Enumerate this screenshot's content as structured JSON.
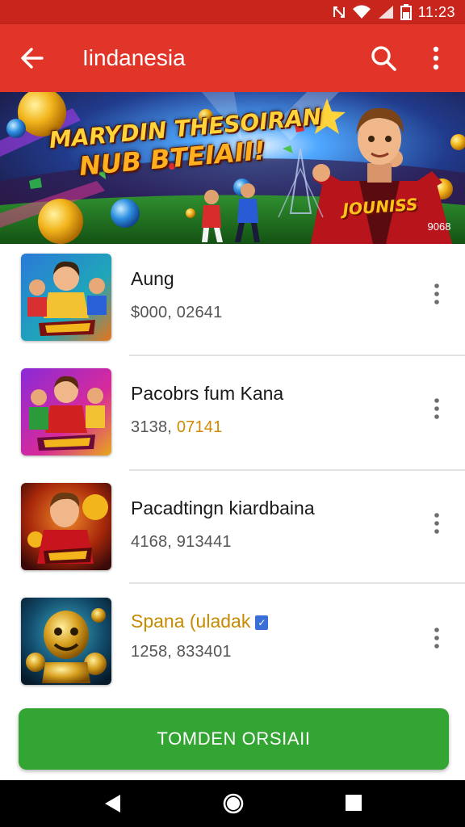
{
  "status_bar": {
    "time": "11:23",
    "icons": [
      "nfc-icon",
      "wifi-icon",
      "signal-icon",
      "battery-icon"
    ]
  },
  "app_bar": {
    "title": "Iindanesia",
    "icons": {
      "back": "arrow-left-icon",
      "search": "search-icon",
      "more": "more-vertical-icon"
    }
  },
  "banner": {
    "headline_line1": "MARYDIN THESOIRAN",
    "headline_line2": "NUB BTEIAII!",
    "logo_text": "JOUNISS",
    "badge": "9068"
  },
  "items": [
    {
      "name": "Aung",
      "sub_prefix": "$000, 02641",
      "sub_highlight": ""
    },
    {
      "name": "Pacobrs fum Kana",
      "sub_prefix": "3138, ",
      "sub_highlight": "07141"
    },
    {
      "name": "Pacadtingn kiardbaina",
      "sub_prefix": "4168, 913441",
      "sub_highlight": ""
    },
    {
      "name": "Spana (uladak",
      "sub_prefix": "1258, 833401",
      "sub_highlight": "",
      "verified": true
    }
  ],
  "cta": {
    "label": "TOMDEN ORSIAII"
  },
  "nav": {
    "back": "triangle-back-icon",
    "home": "circle-home-icon",
    "recents": "square-recents-icon"
  },
  "colors": {
    "status_bar": "#c8261c",
    "app_bar": "#e2352a",
    "cta": "#32a532",
    "highlight": "#d08a00"
  }
}
